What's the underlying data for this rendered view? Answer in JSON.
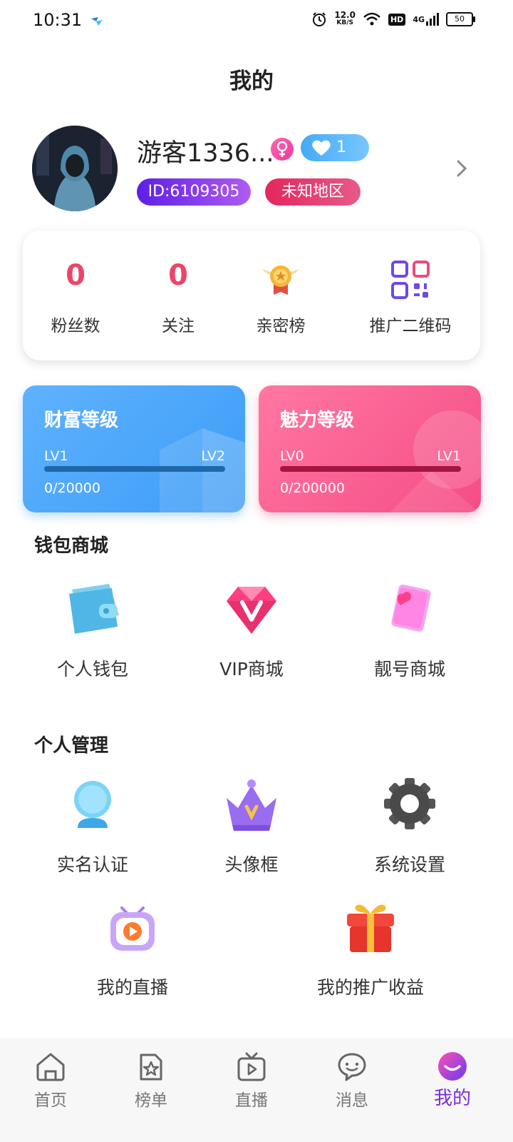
{
  "status_bar": {
    "time": "10:31",
    "net_speed_value": "12.0",
    "net_speed_unit": "KB/S",
    "hd": "HD",
    "signal_label": "4G",
    "battery": "50"
  },
  "header": {
    "title": "我的"
  },
  "profile": {
    "username": "游客1336...",
    "gender_icon": "female-icon",
    "heart_count": "1",
    "id_label": "ID:6109305",
    "region": "未知地区"
  },
  "stats": {
    "fans_value": "0",
    "fans_label": "粉丝数",
    "follow_value": "0",
    "follow_label": "关注",
    "intimacy_label": "亲密榜",
    "qr_label": "推广二维码"
  },
  "levels": {
    "wealth": {
      "title": "财富等级",
      "current": "LV1",
      "next": "LV2",
      "exp": "0/20000",
      "progress": 0
    },
    "charm": {
      "title": "魅力等级",
      "current": "LV0",
      "next": "LV1",
      "exp": "0/200000",
      "progress": 0
    }
  },
  "wallet_section": {
    "title": "钱包商城",
    "items": [
      {
        "label": "个人钱包",
        "icon": "wallet-icon"
      },
      {
        "label": "VIP商城",
        "icon": "diamond-icon"
      },
      {
        "label": "靓号商城",
        "icon": "heart-card-icon"
      }
    ]
  },
  "manage_section": {
    "title": "个人管理",
    "items": [
      {
        "label": "实名认证",
        "icon": "user-verify-icon"
      },
      {
        "label": "头像框",
        "icon": "crown-icon"
      },
      {
        "label": "系统设置",
        "icon": "gear-icon"
      },
      {
        "label": "我的直播",
        "icon": "tv-play-icon"
      },
      {
        "label": "我的推广收益",
        "icon": "gift-icon"
      }
    ]
  },
  "bottom_nav": {
    "items": [
      {
        "label": "首页",
        "icon": "home-icon"
      },
      {
        "label": "榜单",
        "icon": "ranking-icon"
      },
      {
        "label": "直播",
        "icon": "live-tv-icon"
      },
      {
        "label": "消息",
        "icon": "message-icon"
      },
      {
        "label": "我的",
        "icon": "profile-smile-icon"
      }
    ],
    "active_index": 4
  },
  "colors": {
    "accent_purple": "#7a2ee0",
    "stat_red": "#ee4466",
    "wealth_blue": "#3d9cf6",
    "charm_pink": "#f54d85"
  }
}
